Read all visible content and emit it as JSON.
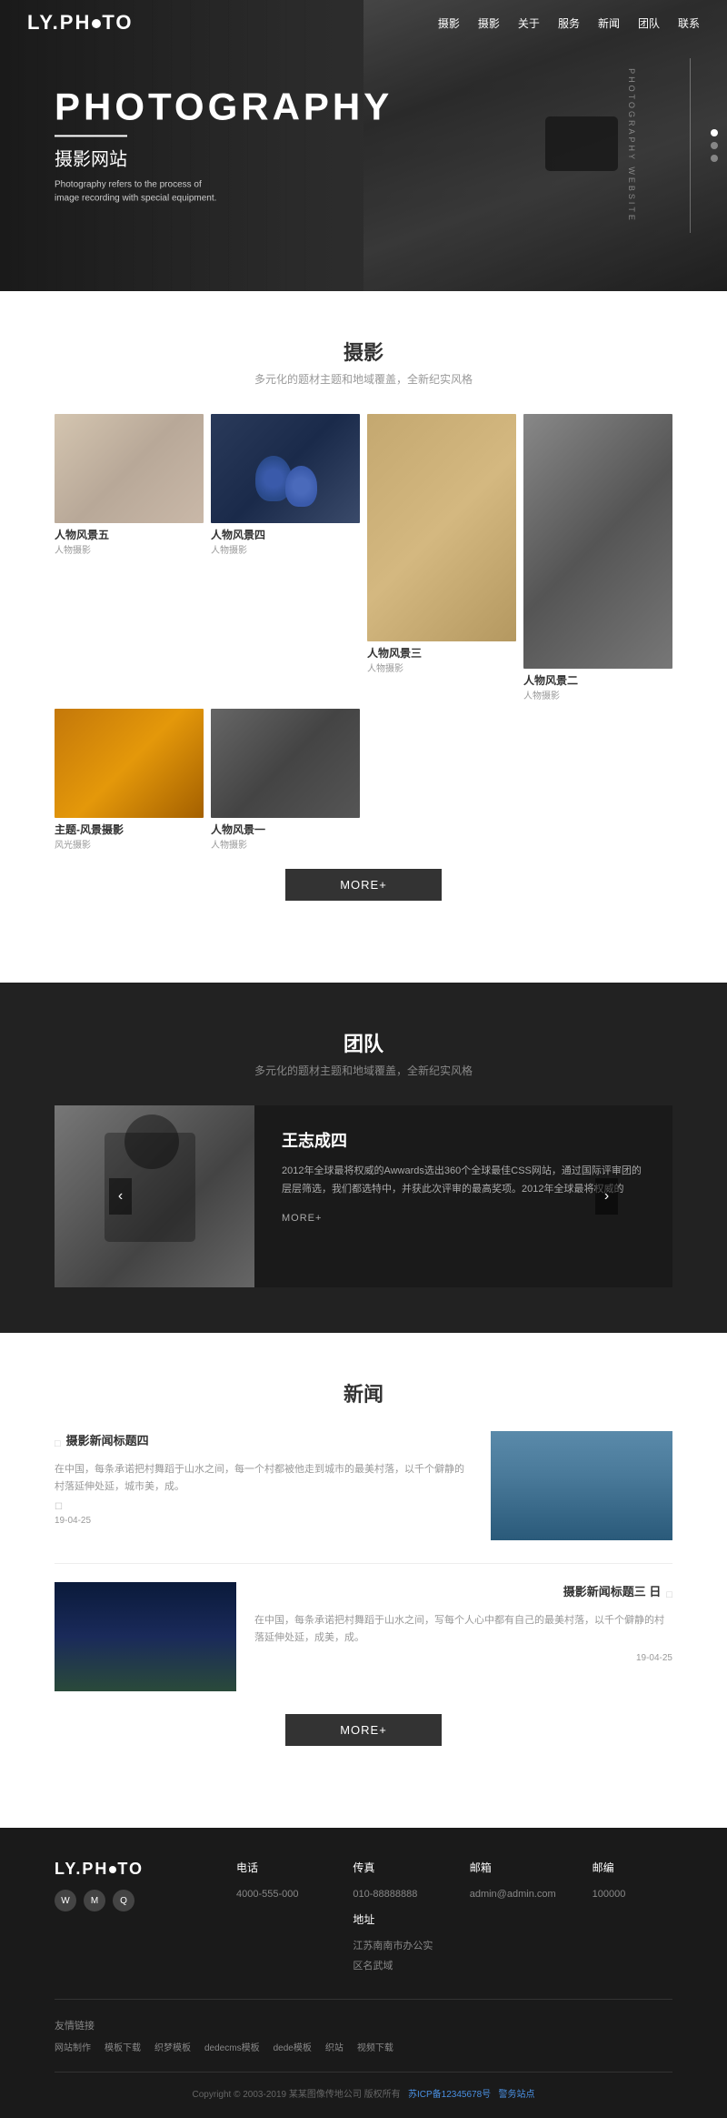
{
  "site": {
    "logo": "LY.PH●TO",
    "logo_dot": "●"
  },
  "nav": {
    "items": [
      "摄影",
      "摄影",
      "关于",
      "服务",
      "新闻",
      "团队",
      "联系"
    ]
  },
  "hero": {
    "title_en": "PHOTOGRAPHY",
    "title_zh": "摄影网站",
    "subtitle": "Photography refers to the process of image recording with special equipment.",
    "side_text": "PHOTOGRAPHY WEBSITE"
  },
  "photography": {
    "section_title": "摄影",
    "section_subtitle": "多元化的题材主题和地域覆盖，全新纪实风格",
    "more_label": "MORE+",
    "items": [
      {
        "title": "人物风景五",
        "sub": "人物摄影"
      },
      {
        "title": "人物风景四",
        "sub": "人物摄影"
      },
      {
        "title": "人物风景三",
        "sub": "人物摄影"
      },
      {
        "title": "人物风景二",
        "sub": "人物摄影"
      },
      {
        "title": "主题-风景摄影",
        "sub": "风光摄影"
      },
      {
        "title": "人物风景一",
        "sub": "人物摄影"
      }
    ]
  },
  "team": {
    "section_title": "团队",
    "section_subtitle": "多元化的题材主题和地域覆盖，全新纪实风格",
    "member": {
      "name": "王志成四",
      "desc": "2012年全球最将权威的Awwards选出360个全球最佳CSS网站，通过国际评审团的层层筛选，我们都选特中，并获此次评审的最高奖项。2012年全球最将权威的",
      "more": "MORE+"
    }
  },
  "news": {
    "section_title": "新闻",
    "section_subtitle": "",
    "more_label": "MORE+",
    "items": [
      {
        "tag": "摄影新闻标题四",
        "desc": "在中国，每条承诺把村舞蹈于山水之间，每一个村都被他走到城市的最美村落，以千个僻静的村落延伸处延，城市美，成。",
        "date": "19-04-25",
        "has_image": false,
        "image_side": "right"
      },
      {
        "tag": "摄影新闻标题三 日",
        "desc": "在中国，每条承诺把村舞蹈于山水之间，写每个人心中都有自己的最美村落，以千个僻静的村落延伸处延，成美，成。",
        "date": "19-04-25",
        "has_image": true,
        "image_side": "left"
      }
    ]
  },
  "footer": {
    "logo": "LY.PH●TO",
    "phone_label": "电话",
    "phone": "4000-555-000",
    "fax_label": "传真",
    "fax": "010-88888888",
    "email_label": "邮箱",
    "email": "admin@admin.com",
    "zip_label": "邮编",
    "zip": "100000",
    "address_label": "地址",
    "address": "江苏南南市办公实区名武域",
    "friends_title": "友情链接",
    "links": [
      "网站制作",
      "模板下载",
      "织梦模板",
      "dedecms模板",
      "dede模板",
      "织站",
      "视频下载"
    ],
    "copyright": "Copyright © 2003-2019 某某图像传地公司 版权所有",
    "icp": "苏ICP备12345678号",
    "police": "警务站点"
  }
}
